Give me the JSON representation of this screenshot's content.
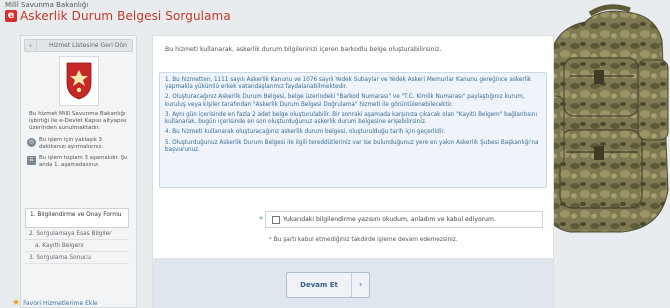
{
  "header": {
    "ministry": "Millî Savunma Bakanlığı",
    "logo_letter": "e",
    "title": "Askerlik Durum Belgesi Sorgulama"
  },
  "sidebar": {
    "back_label": "Hizmet Listesine Geri Dön",
    "back_icon": "chevron-left-icon",
    "info": "Bu hizmet Millî Savunma Bakanlığı işbirliği ile e-Devlet Kapısı altyapısı üzerinden sunulmaktadır.",
    "notes": [
      {
        "icon": "clock-icon",
        "text": "Bu işlem için yaklaşık 3 dakikanızı ayırmalısınız."
      },
      {
        "icon": "steps-icon",
        "text": "Bu işlem toplam 3 aşamalıdır. Şu anda 1. aşamadasınız."
      }
    ],
    "steps": [
      {
        "label": "1. Bilgilendirme ve Onay Formu",
        "active": true
      },
      {
        "label": "2. Sorgulamaya Esas Bilgiler",
        "active": false
      },
      {
        "label": "a. Kayıtlı Belgeni",
        "active": false
      },
      {
        "label": "3. Sorgulama Sonucu",
        "active": false
      }
    ],
    "favorites_label": "Favori Hizmetlerime Ekle"
  },
  "main": {
    "intro": "Bu hizmeti kullanarak, askerlik durum bilgilerinizi içeren barkodlu belge oluşturabilirsiniz.",
    "info_items": [
      "1. Bu hizmetten, 1111 sayılı Askerlik Kanunu ve 1076 sayılı Yedek Subaylar ve Yedek Askeri Memurlar Kanunu gereğince askerlik yapmakla yükümlü erkek vatandaşlarımız faydalanabilmektedir.",
      "2. Oluşturacağınız Askerlik Durum Belgesi, belge üzerindeki \"Barkod Numarası\" ve \"T.C. Kimlik Numarası\" paylaştığınız kurum, kuruluş veya kişiler tarafından \"Askerlik Durum Belgesi Doğrulama\" hizmeti ile görüntülenebilecektir.",
      "3. Aynı gün içerisinde en fazla 2 adet belge oluşturulabilir. Bir sonraki aşamada karşınıza çıkacak olan \"Kayıtlı Belgem\" bağlantısını kullanarak, bugün içerisinde en son oluşturduğunuz askerlik durum belgesine erişebilirsiniz.",
      "4. Bu hizmeti kullanarak oluşturacağınız askerlik durum belgesi, oluşturulduğu tarih için geçerlidir.",
      "5. Oluşturduğunuz Askerlik Durum Belgesi ile ilgili tereddütleriniz var ise bulunduğunuz yere en yakın Askerlik Şubesi Başkanlığı'na başvurunuz."
    ],
    "consent_star": "*",
    "consent_label": "Yukarıdaki bilgilendirme yazısını okudum, anladım ve kabul ediyorum.",
    "warning_star": "*",
    "warning": "Bu şartı kabul etmediğiniz takdirde işleme devam edemezsiniz.",
    "continue_label": "Devam Et",
    "continue_icon": "chevron-right-icon"
  },
  "colors": {
    "title": "#c0392b",
    "info_text": "#3b6b94",
    "info_bg": "#eef4fa",
    "button_text": "#375f8c"
  }
}
